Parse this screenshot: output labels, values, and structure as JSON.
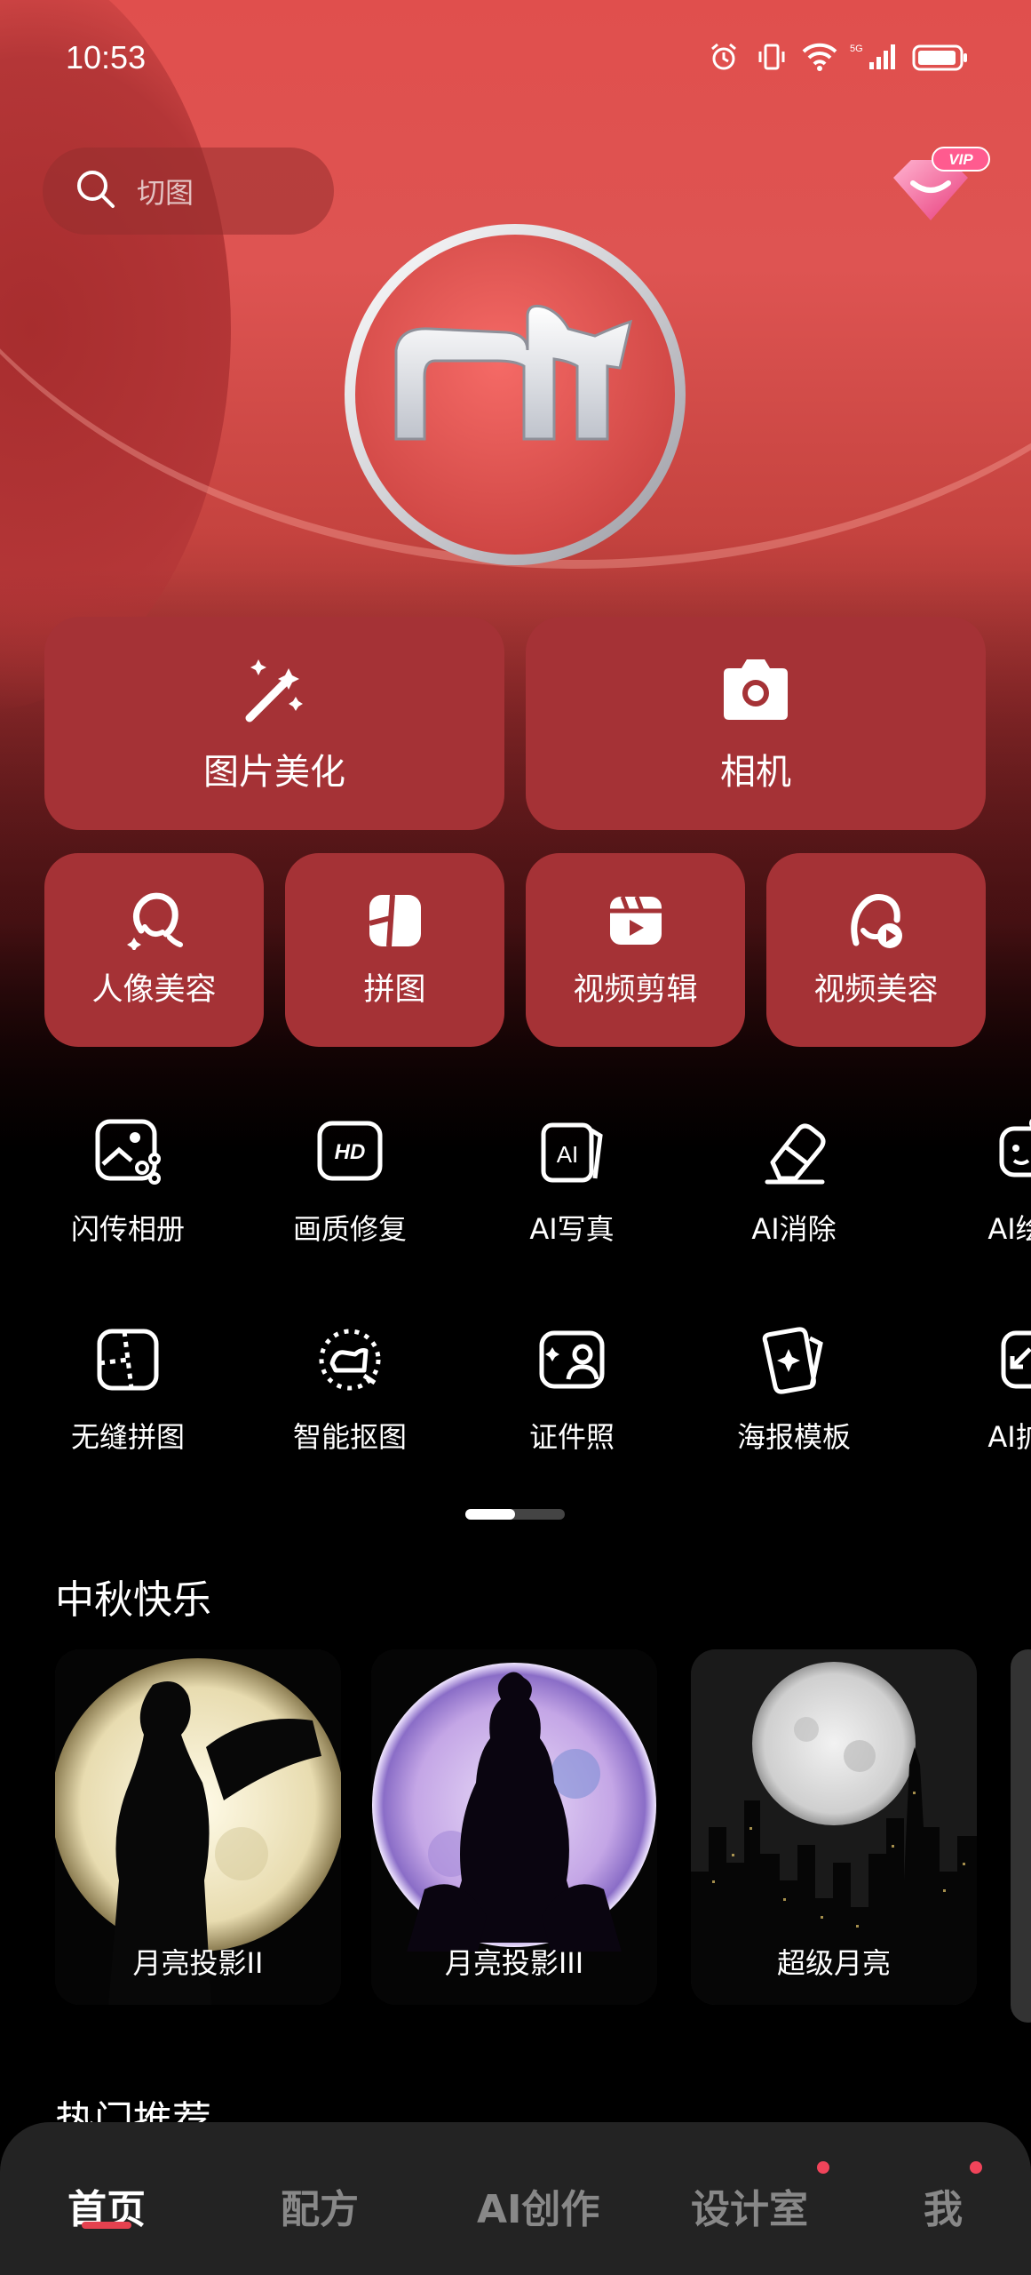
{
  "status_bar": {
    "time": "10:53",
    "signal_label": "5G"
  },
  "search": {
    "placeholder": "切图"
  },
  "vip": {
    "label": "VIP"
  },
  "primary_actions": [
    {
      "label": "图片美化",
      "icon": "magic-wand-icon"
    },
    {
      "label": "相机",
      "icon": "camera-icon"
    }
  ],
  "secondary_actions": [
    {
      "label": "人像美容",
      "icon": "portrait-icon"
    },
    {
      "label": "拼图",
      "icon": "collage-icon"
    },
    {
      "label": "视频剪辑",
      "icon": "video-clip-icon"
    },
    {
      "label": "视频美容",
      "icon": "video-beauty-icon"
    }
  ],
  "tools_row1": [
    {
      "label": "闪传相册",
      "icon": "album-share-icon"
    },
    {
      "label": "画质修复",
      "icon": "hd-icon"
    },
    {
      "label": "AI写真",
      "icon": "ai-portrait-icon"
    },
    {
      "label": "AI消除",
      "icon": "eraser-icon"
    },
    {
      "label": "AI绘",
      "icon": "ai-draw-icon"
    }
  ],
  "tools_row2": [
    {
      "label": "无缝拼图",
      "icon": "seamless-collage-icon"
    },
    {
      "label": "智能抠图",
      "icon": "smart-cutout-icon"
    },
    {
      "label": "证件照",
      "icon": "id-photo-icon"
    },
    {
      "label": "海报模板",
      "icon": "poster-template-icon"
    },
    {
      "label": "AI扩",
      "icon": "ai-expand-icon"
    }
  ],
  "pager": {
    "pages": 2,
    "current": 1
  },
  "section": {
    "title": "中秋快乐"
  },
  "cards": [
    {
      "label": "月亮投影II"
    },
    {
      "label": "月亮投影III"
    },
    {
      "label": "超级月亮"
    }
  ],
  "section2": {
    "title": "热门推荐"
  },
  "tabs": [
    {
      "label": "首页",
      "active": true
    },
    {
      "label": "配方"
    },
    {
      "label": "AI创作"
    },
    {
      "label": "设计室",
      "badge": true
    },
    {
      "label": "我",
      "badge": true
    }
  ],
  "colors": {
    "accent": "#e5414f",
    "button_bg": "#a53236",
    "hero_top": "#e04f4d",
    "tabbar": "#232323"
  }
}
